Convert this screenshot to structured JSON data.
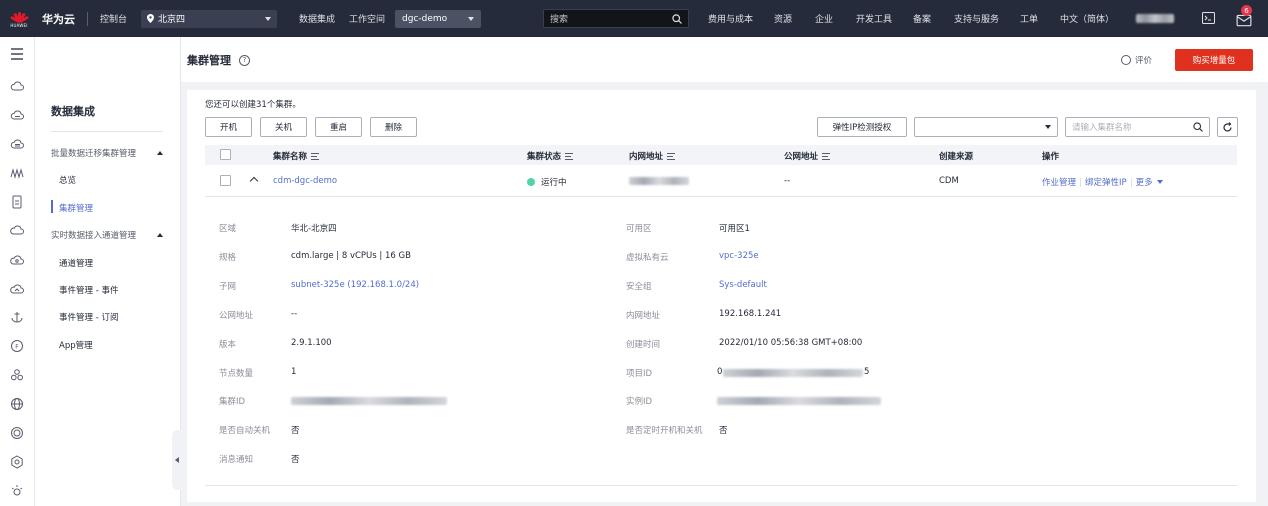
{
  "topbar": {
    "logo_text": "HUAWEI",
    "brand": "华为云",
    "console": "控制台",
    "region": "北京四",
    "nav_data_integration": "数据集成",
    "nav_workspace": "工作空间",
    "workspace": "dgc-demo",
    "search_placeholder": "搜索",
    "links": [
      "费用与成本",
      "资源",
      "企业",
      "开发工具",
      "备案",
      "支持与服务",
      "工单",
      "中文（简体）"
    ],
    "notification_count": "6"
  },
  "sidebar": {
    "title": "数据集成",
    "group1": "批量数据迁移集群管理",
    "items1": [
      "总览",
      "集群管理"
    ],
    "group2": "实时数据接入通道管理",
    "items2": [
      "通道管理",
      "事件管理 - 事件",
      "事件管理 - 订阅",
      "App管理"
    ]
  },
  "header": {
    "title": "集群管理",
    "help": "?",
    "rate": "评价",
    "buy": "购买增量包"
  },
  "toolbar": {
    "quota": "您还可以创建31个集群。",
    "start": "开机",
    "stop": "关机",
    "restart": "重启",
    "delete": "删除",
    "eip_auth": "弹性IP检测授权",
    "filter_value": "",
    "search_placeholder": "请输入集群名称"
  },
  "table": {
    "columns": [
      "集群名称",
      "集群状态",
      "内网地址",
      "公网地址",
      "创建来源",
      "操作"
    ],
    "row": {
      "name": "cdm-dgc-demo",
      "status": "运行中",
      "public_ip": "--",
      "source": "CDM",
      "op1": "作业管理",
      "op2": "绑定弹性IP",
      "op3": "更多"
    }
  },
  "details": {
    "left": [
      {
        "label": "区域",
        "value": "华北-北京四"
      },
      {
        "label": "规格",
        "value": "cdm.large | 8 vCPUs | 16 GB"
      },
      {
        "label": "子网",
        "value": "subnet-325e (192.168.1.0/24)"
      },
      {
        "label": "公网地址",
        "value": "--"
      },
      {
        "label": "版本",
        "value": "2.9.1.100"
      },
      {
        "label": "节点数量",
        "value": "1"
      },
      {
        "label": "集群ID",
        "value": ""
      },
      {
        "label": "是否自动关机",
        "value": "否"
      },
      {
        "label": "消息通知",
        "value": "否"
      }
    ],
    "right": [
      {
        "label": "可用区",
        "value": "可用区1"
      },
      {
        "label": "虚拟私有云",
        "value": "vpc-325e"
      },
      {
        "label": "安全组",
        "value": "Sys-default"
      },
      {
        "label": "内网地址",
        "value": "192.168.1.241"
      },
      {
        "label": "创建时间",
        "value": "2022/01/10 05:56:38 GMT+08:00"
      },
      {
        "label": "项目ID",
        "value": ""
      },
      {
        "label": "实例ID",
        "value": ""
      },
      {
        "label": "是否定时开机和关机",
        "value": "否"
      }
    ],
    "project_id_tail": "5",
    "project_id_head": "0"
  },
  "colors": {
    "primary": "#526ecc",
    "buy": "#e0301e",
    "running": "#50d4ab",
    "topbar": "#252b3a"
  }
}
